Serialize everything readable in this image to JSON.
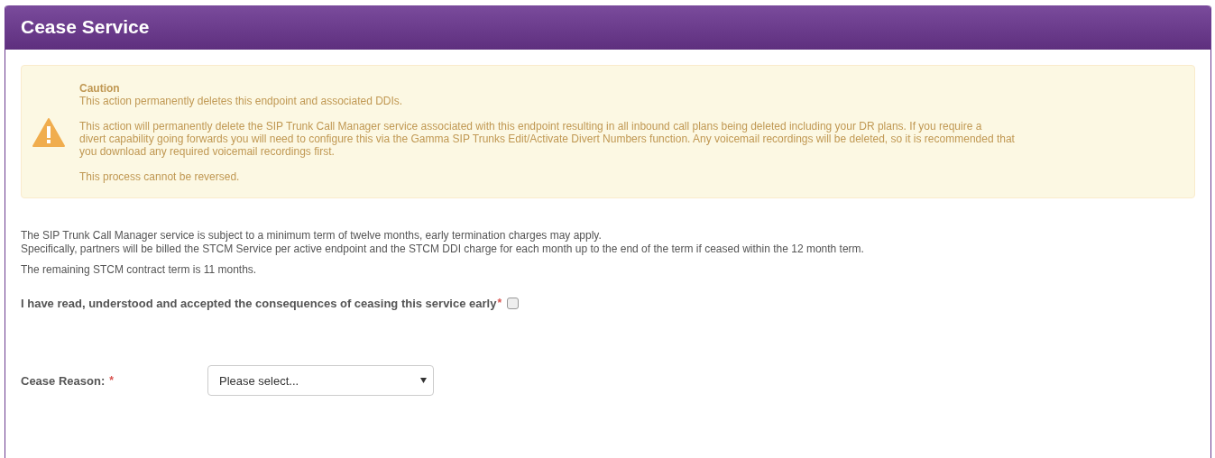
{
  "panel": {
    "title": "Cease Service"
  },
  "caution": {
    "heading": "Caution",
    "summary": "This action permanently deletes this endpoint and associated DDIs.",
    "details": [
      "This action will permanently delete the SIP Trunk Call Manager service associated with this endpoint resulting in all inbound call plans being deleted including your DR plans. If you require a",
      "divert capability going forwards you will need to configure this via the Gamma SIP Trunks Edit/Activate Divert Numbers function. Any voicemail recordings will be deleted, so it is recommended that",
      "you download any required voicemail recordings first."
    ],
    "note": "This process cannot be reversed."
  },
  "terms": [
    "The SIP Trunk Call Manager service is subject to a minimum term of twelve months, early termination charges may apply.",
    "Specifically, partners will be billed the STCM Service per active endpoint and the STCM DDI charge for each month up to the end of the term if ceased within the 12 month term."
  ],
  "remaining": "The remaining STCM contract term is 11 months.",
  "acknowledge": {
    "label": "I have read, understood and accepted the consequences of ceasing this service early",
    "required": "*",
    "checked": false
  },
  "cease_reason": {
    "label": "Cease Reason:",
    "required": "*",
    "value": "Please select..."
  }
}
